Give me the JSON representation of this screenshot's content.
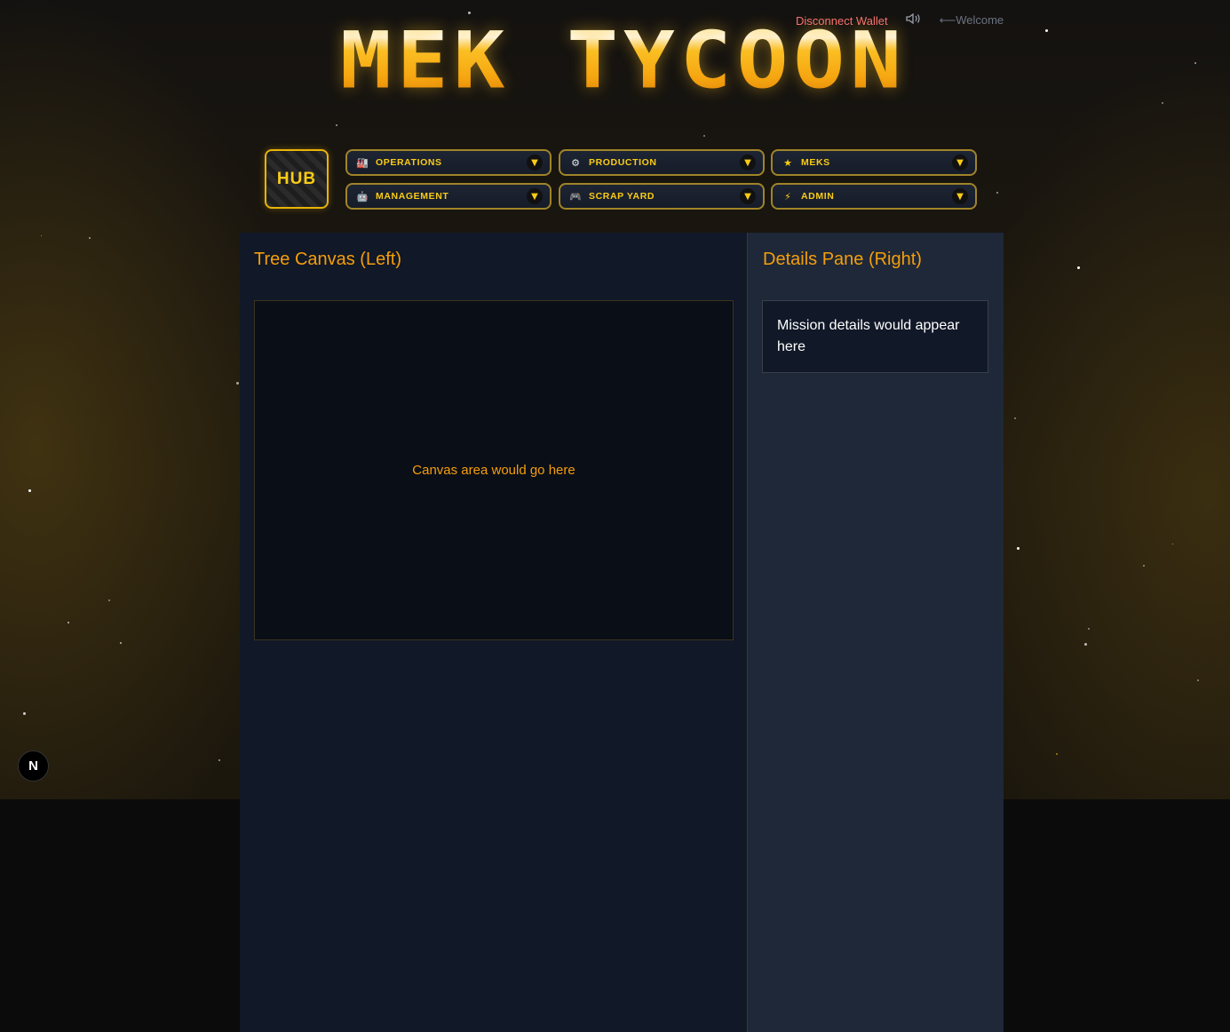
{
  "header": {
    "logo_text": "MEK TYCOON",
    "disconnect_label": "Disconnect Wallet",
    "sound_icon": "speaker-icon",
    "welcome_label": "⟵Welcome"
  },
  "nav": {
    "hub_label": "HUB",
    "buttons": [
      {
        "label": "OPERATIONS",
        "icon": "factory-icon",
        "glyph": "🏭"
      },
      {
        "label": "PRODUCTION",
        "icon": "gear-icon",
        "glyph": "⚙"
      },
      {
        "label": "MEKS",
        "icon": "star-icon",
        "glyph": "★"
      },
      {
        "label": "MANAGEMENT",
        "icon": "robot-icon",
        "glyph": "🤖"
      },
      {
        "label": "SCRAP YARD",
        "icon": "gamepad-icon",
        "glyph": "🎮"
      },
      {
        "label": "ADMIN",
        "icon": "lightning-icon",
        "glyph": "⚡"
      }
    ],
    "chevron": "▼"
  },
  "main": {
    "left_title": "Tree Canvas (Left)",
    "canvas_placeholder": "Canvas area would go here",
    "right_title": "Details Pane (Right)",
    "details_placeholder": "Mission details would appear here"
  },
  "devtools": {
    "badge_label": "N"
  },
  "colors": {
    "accent": "#f59e0b",
    "gold": "#facc15",
    "danger": "#f87171"
  }
}
